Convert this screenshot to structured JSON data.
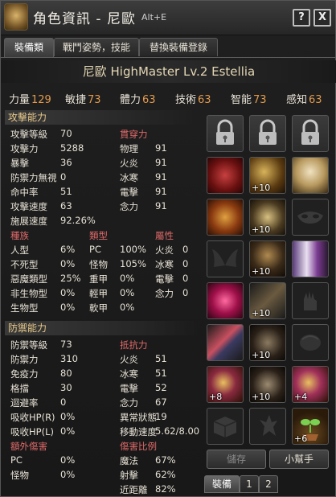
{
  "window": {
    "title": "角色資訊 - 尼歐",
    "hotkey": "Alt+E",
    "help_label": "?",
    "close_label": "X"
  },
  "tabs": [
    {
      "label": "裝備類",
      "active": true
    },
    {
      "label": "戰鬥姿勢，技能",
      "active": false
    },
    {
      "label": "替換裝備登錄",
      "active": false
    }
  ],
  "character": {
    "line": "尼歐  HighMaster Lv.2  Estellia"
  },
  "attributes": [
    {
      "label": "力量",
      "value": "129"
    },
    {
      "label": "敏捷",
      "value": "73"
    },
    {
      "label": "體力",
      "value": "63"
    },
    {
      "label": "技術",
      "value": "63"
    },
    {
      "label": "智能",
      "value": "73"
    },
    {
      "label": "感知",
      "value": "63"
    }
  ],
  "attack": {
    "section_title": "攻擊能力",
    "stats": [
      {
        "label": "攻擊等級",
        "value": "70"
      },
      {
        "label": "攻擊力",
        "value": "5288"
      },
      {
        "label": "暴擊",
        "value": "36"
      },
      {
        "label": "防禦力無視",
        "value": "0"
      },
      {
        "label": "命中率",
        "value": "51"
      },
      {
        "label": "攻擊速度",
        "value": "63"
      },
      {
        "label": "施展速度",
        "value": "92.26%"
      }
    ],
    "penetration_title": "貫穿力",
    "penetration": [
      {
        "label": "物理",
        "value": "91"
      },
      {
        "label": "火炎",
        "value": "91"
      },
      {
        "label": "冰寒",
        "value": "91"
      },
      {
        "label": "電擊",
        "value": "91"
      },
      {
        "label": "念力",
        "value": "91"
      }
    ],
    "race_title": "種族",
    "type_title": "類型",
    "element_title": "屬性",
    "race": [
      {
        "label": "人型",
        "value": "6%"
      },
      {
        "label": "不死型",
        "value": "0%"
      },
      {
        "label": "惡魔類型",
        "value": "25%"
      },
      {
        "label": "非生物型",
        "value": "0%"
      },
      {
        "label": "生物型",
        "value": "0%"
      }
    ],
    "type": [
      {
        "label": "PC",
        "value": "100%"
      },
      {
        "label": "怪物",
        "value": "105%"
      },
      {
        "label": "重甲",
        "value": "0%"
      },
      {
        "label": "輕甲",
        "value": "0%"
      },
      {
        "label": "軟甲",
        "value": "0%"
      }
    ],
    "element": [
      {
        "label": "火炎",
        "value": "0"
      },
      {
        "label": "冰寒",
        "value": "0"
      },
      {
        "label": "電擊",
        "value": "0"
      },
      {
        "label": "念力",
        "value": "0"
      }
    ]
  },
  "defense": {
    "section_title": "防禦能力",
    "stats": [
      {
        "label": "防禦等級",
        "value": "73"
      },
      {
        "label": "防禦力",
        "value": "310"
      },
      {
        "label": "免疫力",
        "value": "80"
      },
      {
        "label": "格擋",
        "value": "30"
      },
      {
        "label": "迴避率",
        "value": "0"
      },
      {
        "label": "吸收HP(R)",
        "value": "0%"
      },
      {
        "label": "吸收HP(L)",
        "value": "0%"
      }
    ],
    "resist_title": "抵抗力",
    "resist": [
      {
        "label": "火炎",
        "value": "51"
      },
      {
        "label": "冰寒",
        "value": "51"
      },
      {
        "label": "電擊",
        "value": "52"
      },
      {
        "label": "念力",
        "value": "67"
      },
      {
        "label": "異常狀態",
        "value": "19"
      },
      {
        "label": "移動速度",
        "value": "5.62/8.00"
      }
    ],
    "extra_damage_title": "額外傷害",
    "extra_damage": [
      {
        "label": "PC",
        "value": "0%"
      },
      {
        "label": "怪物",
        "value": "0%"
      }
    ],
    "damage_ratio_title": "傷害比例",
    "damage_ratio": [
      {
        "label": "魔法",
        "value": "67%"
      },
      {
        "label": "射擊",
        "value": "62%"
      },
      {
        "label": "近距離",
        "value": "82%"
      }
    ]
  },
  "equipment": {
    "slots": [
      {
        "name": "locked-slot",
        "level": ""
      },
      {
        "name": "locked-slot",
        "level": ""
      },
      {
        "name": "locked-slot",
        "level": ""
      },
      {
        "name": "emblem",
        "level": ""
      },
      {
        "name": "earring-left",
        "level": "+10"
      },
      {
        "name": "headgear",
        "level": ""
      },
      {
        "name": "amulet",
        "level": ""
      },
      {
        "name": "necklace",
        "level": "+10"
      },
      {
        "name": "mask-empty",
        "level": ""
      },
      {
        "name": "wings-empty",
        "level": ""
      },
      {
        "name": "armor",
        "level": "+10"
      },
      {
        "name": "costume",
        "level": ""
      },
      {
        "name": "weapon-right",
        "level": ""
      },
      {
        "name": "weapon-main",
        "level": "+10"
      },
      {
        "name": "gloves-empty",
        "level": ""
      },
      {
        "name": "sword",
        "level": ""
      },
      {
        "name": "gauntlet",
        "level": "+10"
      },
      {
        "name": "shield-empty",
        "level": ""
      },
      {
        "name": "ring-left",
        "level": "+8"
      },
      {
        "name": "boots",
        "level": "+10"
      },
      {
        "name": "ring-right",
        "level": "+4"
      },
      {
        "name": "belt-empty",
        "level": ""
      },
      {
        "name": "spirit-empty",
        "level": ""
      },
      {
        "name": "pet-sprout",
        "level": "+6"
      }
    ]
  },
  "buttons": {
    "save": "儲存",
    "helper": "小幫手"
  },
  "bottom_tabs": [
    {
      "label": "裝備",
      "active": true
    },
    {
      "label": "1",
      "active": false
    },
    {
      "label": "2",
      "active": false
    }
  ]
}
